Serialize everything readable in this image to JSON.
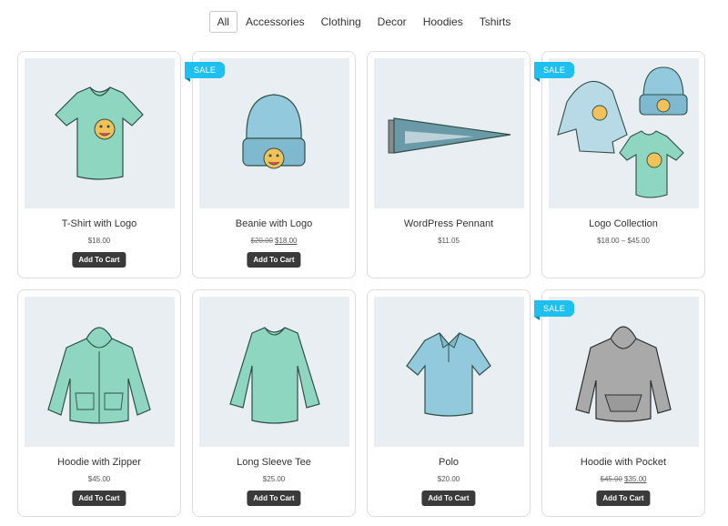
{
  "filters": {
    "all": "All",
    "accessories": "Accessories",
    "clothing": "Clothing",
    "decor": "Decor",
    "hoodies": "Hoodies",
    "tshirts": "Tshirts"
  },
  "sale_label": "SALE",
  "cart_label": "Add To Cart",
  "products": [
    {
      "name": "T-Shirt with Logo",
      "price": "$18.00",
      "image": "tshirt-logo-image"
    },
    {
      "name": "Beanie with Logo",
      "old_price": "$20.00",
      "price": "$18.00",
      "image": "beanie-image",
      "sale": true
    },
    {
      "name": "WordPress Pennant",
      "price": "$11.05",
      "image": "pennant-image"
    },
    {
      "name": "Logo Collection",
      "price": "$18.00 – $45.00",
      "image": "logo-collection-image",
      "sale": true
    },
    {
      "name": "Hoodie with Zipper",
      "price": "$45.00",
      "image": "zip-hoodie-image"
    },
    {
      "name": "Long Sleeve Tee",
      "price": "$25.00",
      "image": "long-sleeve-image"
    },
    {
      "name": "Polo",
      "price": "$20.00",
      "image": "polo-image"
    },
    {
      "name": "Hoodie with Pocket",
      "old_price": "$45.00",
      "price": "$35.00",
      "image": "pocket-hoodie-image",
      "sale": true
    }
  ],
  "colors": {
    "sale_badge": "#1ec0f0",
    "button": "#3a3a3a",
    "image_bg": "#e8eef2",
    "mint": "#8fd6c0",
    "blue": "#92c9dc",
    "gray": "#a9a9a9"
  }
}
